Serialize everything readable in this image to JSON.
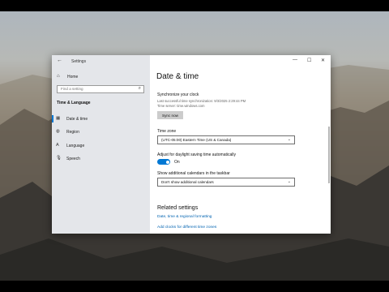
{
  "window": {
    "title": "Settings",
    "controls": {
      "minimize": "—",
      "maximize": "☐",
      "close": "✕"
    }
  },
  "sidebar": {
    "home_label": "Home",
    "search_placeholder": "Find a setting",
    "section_title": "Time & Language",
    "items": [
      {
        "label": "Date & time",
        "icon": "calendar-icon",
        "active": true
      },
      {
        "label": "Region",
        "icon": "globe-icon",
        "active": false
      },
      {
        "label": "Language",
        "icon": "language-icon",
        "active": false
      },
      {
        "label": "Speech",
        "icon": "microphone-icon",
        "active": false
      }
    ]
  },
  "main": {
    "title": "Date & time",
    "sync": {
      "heading": "Synchronize your clock",
      "last_sync": "Last successful time synchronization: 9/3/2025 2:29:44 PM",
      "time_server": "Time server: time.windows.com",
      "button_label": "Sync now"
    },
    "time_zone": {
      "label": "Time zone",
      "value": "(UTC-05:00) Eastern Time (US & Canada)"
    },
    "dst": {
      "label": "Adjust for daylight saving time automatically",
      "state_label": "On",
      "on": true
    },
    "calendars": {
      "label": "Show additional calendars in the taskbar",
      "value": "Don't show additional calendars"
    },
    "related": {
      "heading": "Related settings",
      "links": [
        "Date, time & regional formatting",
        "Add clocks for different time zones"
      ]
    }
  },
  "colors": {
    "accent": "#0078d4",
    "link": "#0063b1",
    "sidebar_bg": "#e4e6ea",
    "content_bg": "#ffffff"
  }
}
